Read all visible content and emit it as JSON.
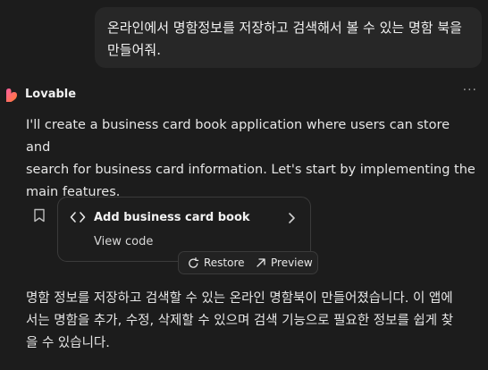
{
  "user_message": {
    "lines": [
      "온라인에서 명함정보를 저장하고 검색해서 볼 수 있는 명함 북을",
      "만들어줘."
    ]
  },
  "assistant": {
    "name": "Lovable",
    "more_label": "···",
    "intro_lines": [
      "I'll create a business card book application where users can store and",
      "search for business card information. Let's start by implementing the",
      "main features."
    ],
    "artifact": {
      "title": "Add business card book",
      "view_code_label": "View code",
      "restore_label": "Restore",
      "preview_label": "Preview"
    },
    "summary_lines": [
      "명함 정보를 저장하고 검색할 수 있는 온라인 명함북이 만들어졌습니다. 이 앱에",
      "서는 명함을 추가, 수정, 삭제할 수 있으며 검색 기능으로 필요한 정보를 쉽게 찾",
      "을 수 있습니다."
    ]
  },
  "colors": {
    "background": "#1c1c1c",
    "bubble": "#272727",
    "logo_gradient": [
      "#ff5fa2",
      "#ff7a2f"
    ]
  }
}
